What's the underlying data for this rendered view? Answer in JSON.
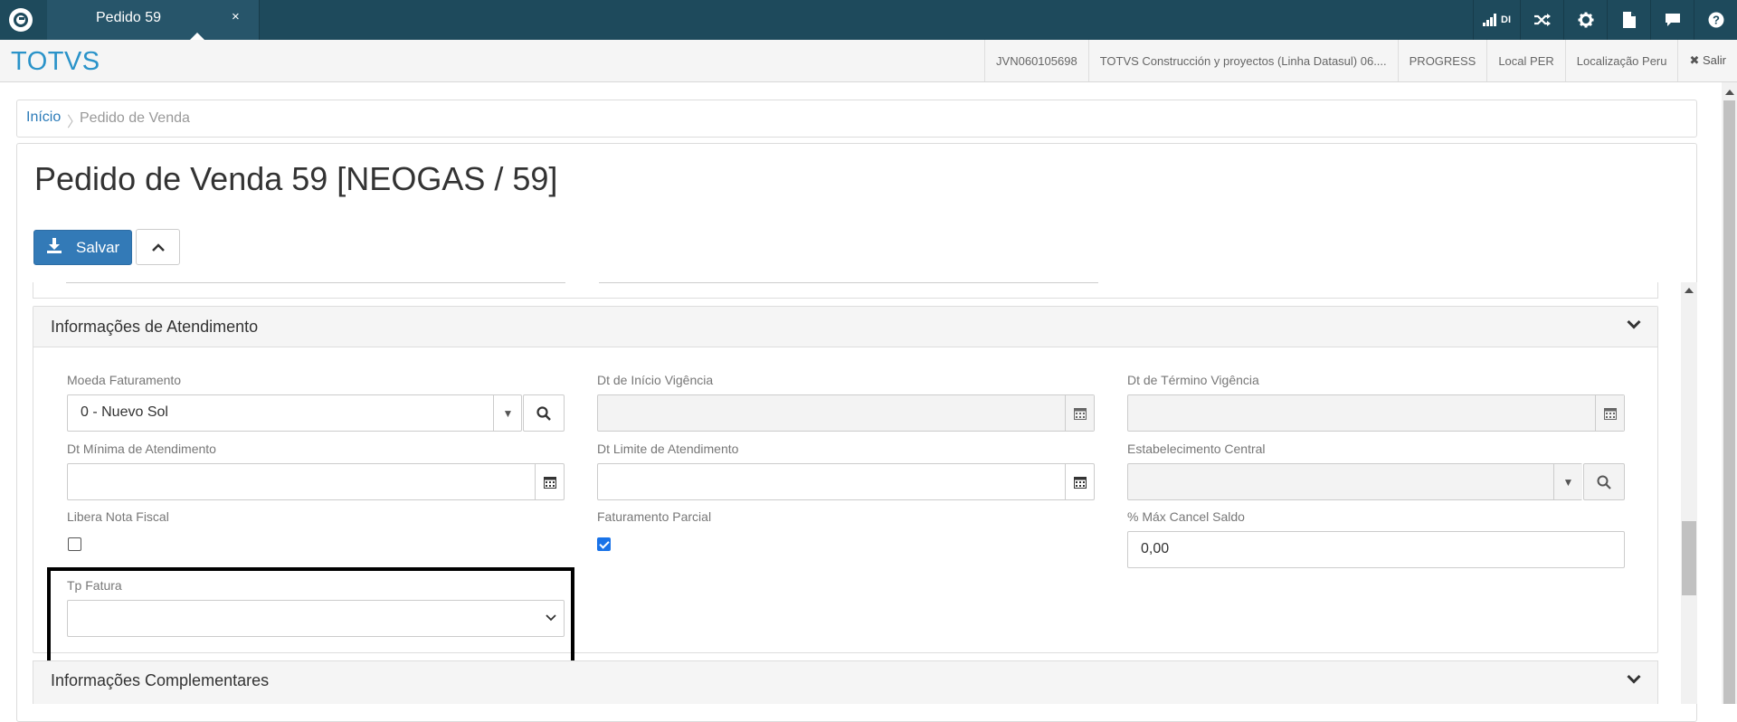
{
  "topbar": {
    "tab_label": "Pedido 59",
    "tab_close": "×",
    "signal_label": "DI"
  },
  "header": {
    "brand": "TOTVS",
    "items": [
      "JVN060105698",
      "TOTVS Construcción y proyectos (Linha Datasul) 06....",
      "PROGRESS",
      "Local PER",
      "Localização Peru"
    ],
    "exit_label": "✖ Salir"
  },
  "breadcrumb": {
    "home": "Início",
    "current": "Pedido de Venda"
  },
  "page": {
    "title": "Pedido de Venda 59 [NEOGAS / 59]",
    "save_label": "Salvar"
  },
  "section_atendimento": {
    "title": "Informações de Atendimento",
    "fields": {
      "moeda_label": "Moeda Faturamento",
      "moeda_value": "0 - Nuevo Sol",
      "dt_inicio_label": "Dt de Início Vigência",
      "dt_termino_label": "Dt de Término Vigência",
      "dt_minima_label": "Dt Mínima de Atendimento",
      "dt_limite_label": "Dt Limite de Atendimento",
      "estab_label": "Estabelecimento Central",
      "libera_label": "Libera Nota Fiscal",
      "libera_checked": false,
      "fat_parcial_label": "Faturamento Parcial",
      "fat_parcial_checked": true,
      "max_cancel_label": "% Máx Cancel Saldo",
      "max_cancel_value": "0,00",
      "tp_fatura_label": "Tp Fatura",
      "tp_fatura_value": ""
    }
  },
  "section_complementares": {
    "title": "Informações Complementares"
  },
  "colors": {
    "topbar": "#1e4a5c",
    "brand": "#2a93c9",
    "primary_button": "#337ab7",
    "checkbox_checked": "#1a73e8"
  }
}
